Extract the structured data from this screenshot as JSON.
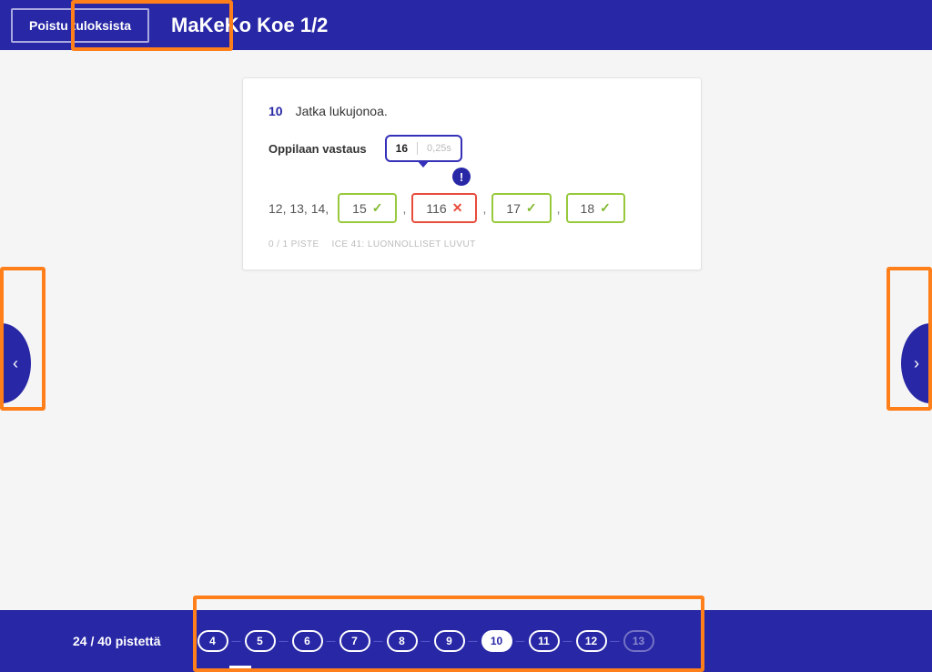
{
  "header": {
    "exit_label": "Poistu tuloksista",
    "title": "MaKeKo Koe 1/2"
  },
  "question": {
    "number": "10",
    "text": "Jatka lukujonoa.",
    "student_answer_label": "Oppilaan vastaus",
    "tooltip": {
      "correct": "16",
      "extra": "0,25s"
    },
    "prefix": "12, 13, 14,",
    "answers": [
      {
        "value": "15",
        "correct": true
      },
      {
        "value": "116",
        "correct": false
      },
      {
        "value": "17",
        "correct": true
      },
      {
        "value": "18",
        "correct": true
      }
    ],
    "separator": ",",
    "points": "0 / 1 PISTE",
    "category": "ICE 41: LUONNOLLISET LUVUT",
    "alert": "!"
  },
  "footer": {
    "score": "24 / 40 pistettä",
    "pages": [
      "4",
      "5",
      "6",
      "7",
      "8",
      "9",
      "10",
      "11",
      "12",
      "13"
    ],
    "active": "10",
    "faded": [
      "13"
    ]
  },
  "nav": {
    "prev": "‹",
    "next": "›"
  }
}
